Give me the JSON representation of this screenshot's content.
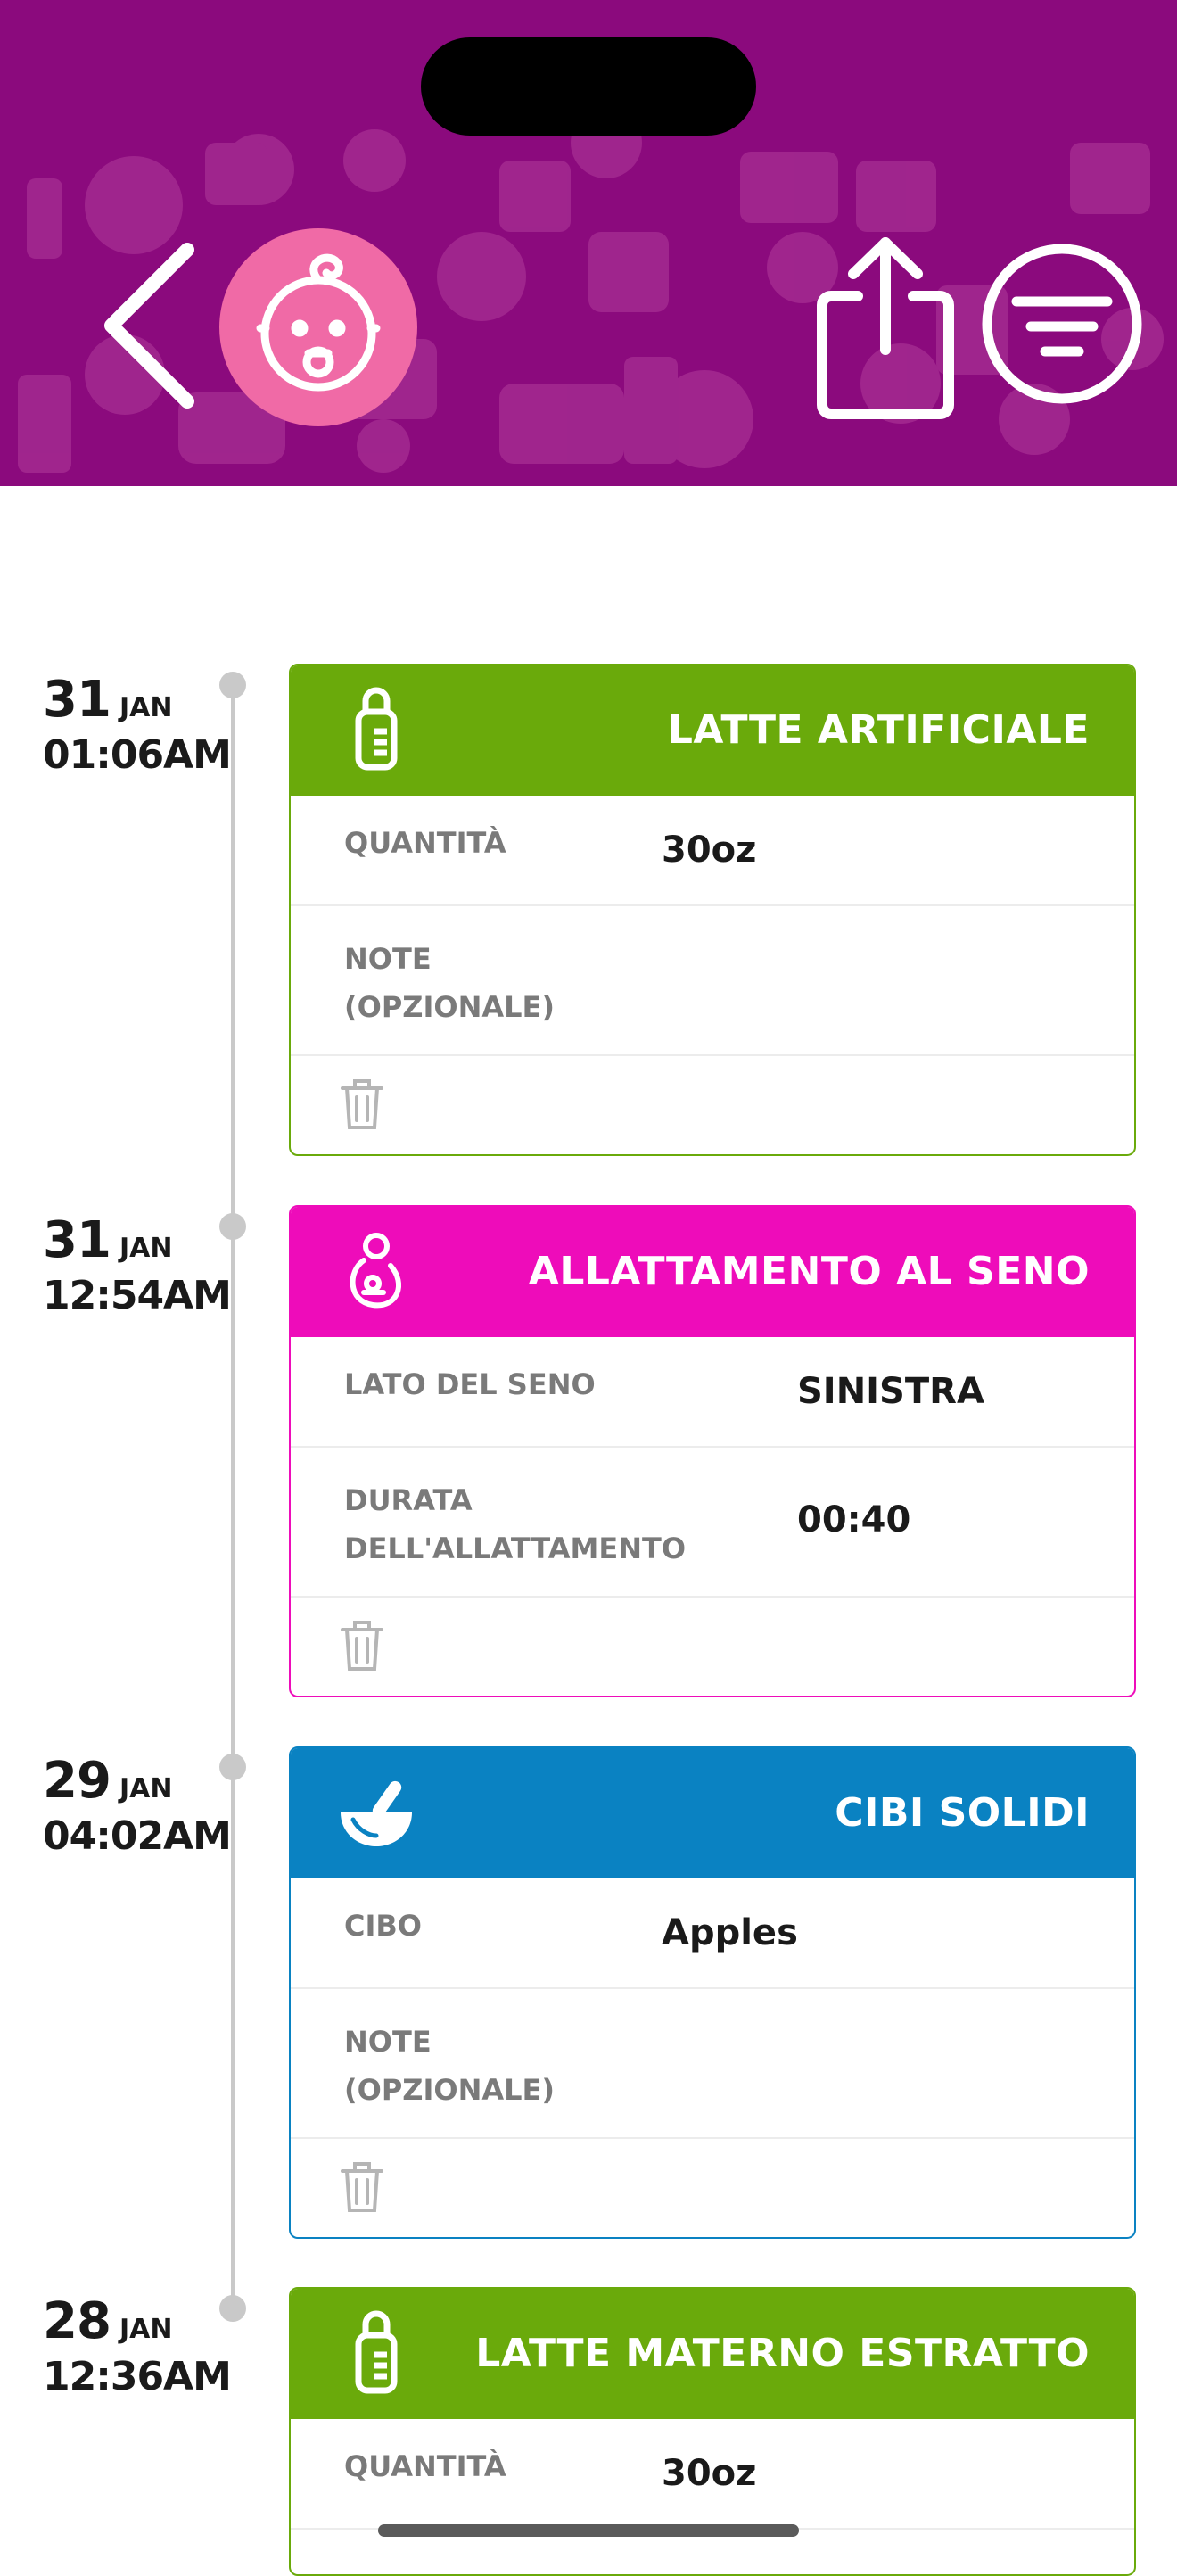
{
  "header": {
    "back_icon": "chevron-left-icon",
    "avatar_icon": "baby-face-icon",
    "share_icon": "share-icon",
    "filter_icon": "filter-icon",
    "background_color": "#8b0a7d",
    "avatar_color": "#f06aa6"
  },
  "entries": [
    {
      "day": "31",
      "month": "JAN",
      "time": "01:06AM",
      "title": "LATTE ARTIFICIALE",
      "icon": "baby-bottle-icon",
      "color": "#6aaa0b",
      "rows": [
        {
          "label": "QUANTITÀ",
          "value": "30oz"
        },
        {
          "label_line1": "NOTE",
          "label_line2": "(OPZIONALE)",
          "value": ""
        }
      ]
    },
    {
      "day": "31",
      "month": "JAN",
      "time": "12:54AM",
      "title": "ALLATTAMENTO AL SENO",
      "icon": "breastfeeding-icon",
      "color": "#ee0cba",
      "rows": [
        {
          "label": "LATO DEL SENO",
          "value": "SINISTRA"
        },
        {
          "label_line1": "DURATA",
          "label_line2": "DELL'ALLATTAMENTO",
          "value": "00:40"
        }
      ]
    },
    {
      "day": "29",
      "month": "JAN",
      "time": "04:02AM",
      "title": "CIBI SOLIDI",
      "icon": "mortar-pestle-icon",
      "color": "#0a82c2",
      "rows": [
        {
          "label": "CIBO",
          "value": "Apples"
        },
        {
          "label_line1": "NOTE",
          "label_line2": "(OPZIONALE)",
          "value": ""
        }
      ]
    },
    {
      "day": "28",
      "month": "JAN",
      "time": "12:36AM",
      "title": "LATTE MATERNO ESTRATTO",
      "icon": "baby-bottle-icon",
      "color": "#6aaa0b",
      "rows": [
        {
          "label": "QUANTITÀ",
          "value": "30oz"
        }
      ]
    }
  ]
}
